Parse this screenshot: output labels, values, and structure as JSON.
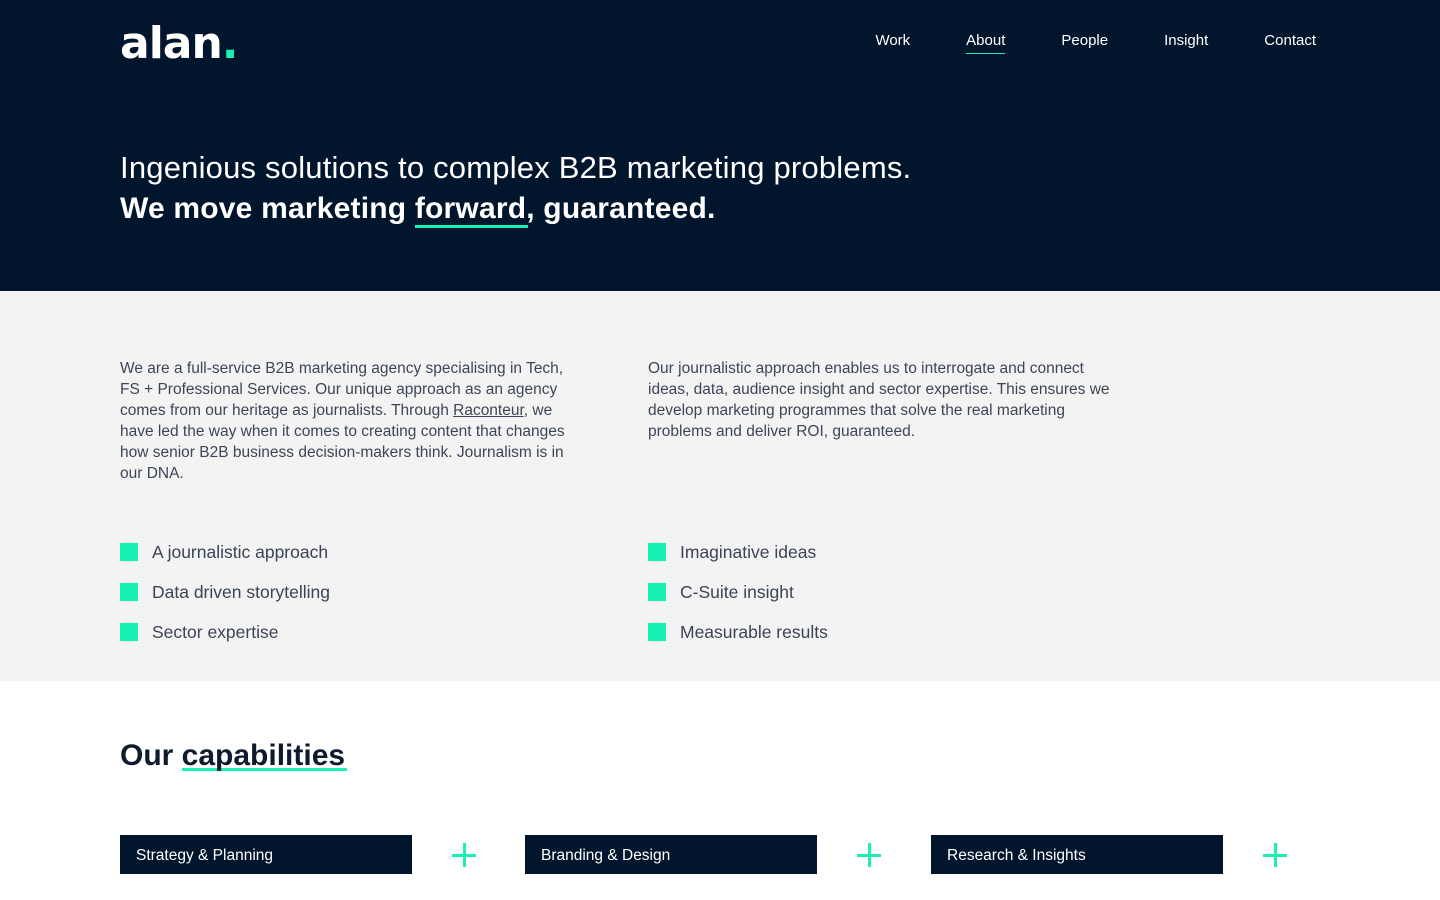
{
  "brand": {
    "name": "alan",
    "dot": ".",
    "accent": "#19f0b4",
    "navy": "#01152d"
  },
  "nav": {
    "items": [
      {
        "label": "Work"
      },
      {
        "label": "About",
        "active": true
      },
      {
        "label": "People"
      },
      {
        "label": "Insight"
      },
      {
        "label": "Contact"
      }
    ]
  },
  "hero": {
    "line1": "Ingenious solutions to complex B2B marketing problems.",
    "line2_before": "We move marketing ",
    "line2_highlight": "forward",
    "line2_after": ", guaranteed."
  },
  "about": {
    "left_before_link": "We are a full-service B2B marketing agency specialising in Tech, FS + Professional Services. Our unique approach as an agency comes from our heritage as journalists. Through ",
    "left_link": "Raconteur",
    "left_after_link": ", we have led the way when it comes to creating content that changes how senior B2B business decision-makers think. Journalism is in our DNA.",
    "right": "Our journalistic approach enables us to interrogate and connect ideas, data, audience insight and sector expertise. This ensures we develop marketing programmes that solve the real marketing problems and deliver ROI, guaranteed."
  },
  "features": {
    "left": [
      "A journalistic approach",
      "Data driven storytelling",
      "Sector expertise"
    ],
    "right": [
      "Imaginative ideas",
      "C-Suite insight",
      "Measurable results"
    ]
  },
  "capabilities": {
    "title_before": "Our ",
    "title_highlight": "capabilities",
    "items": [
      "Strategy & Planning",
      "Branding & Design",
      "Research & Insights"
    ]
  }
}
